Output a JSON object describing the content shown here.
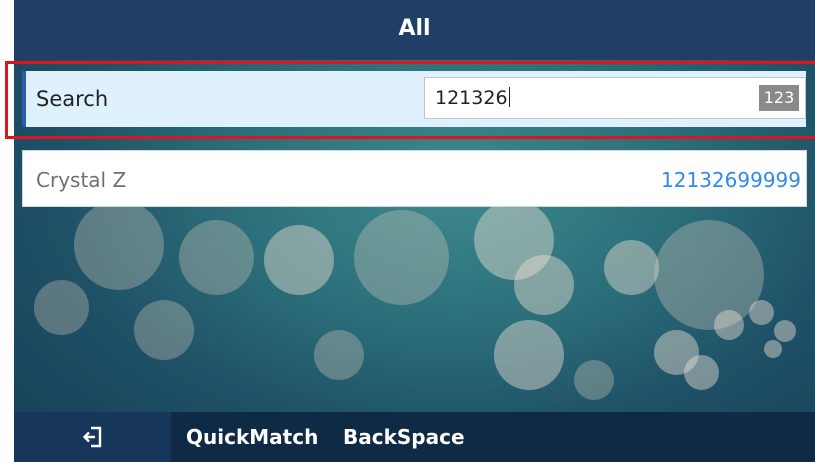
{
  "header": {
    "title": "All"
  },
  "search": {
    "label": "Search",
    "value": "121326",
    "ime_mode": "123"
  },
  "results": [
    {
      "name": "Crystal Z",
      "number": "12132699999"
    }
  ],
  "softkeys": {
    "back_icon": "exit-arrow-icon",
    "quickmatch": "QuickMatch",
    "backspace": "BackSpace"
  },
  "colors": {
    "title_bar": "#1f3f66",
    "selected_row": "#dff1fd",
    "number_text": "#2f8ae8",
    "highlight_box": "#e0141e",
    "softkey_bar": "#0e2a45"
  }
}
